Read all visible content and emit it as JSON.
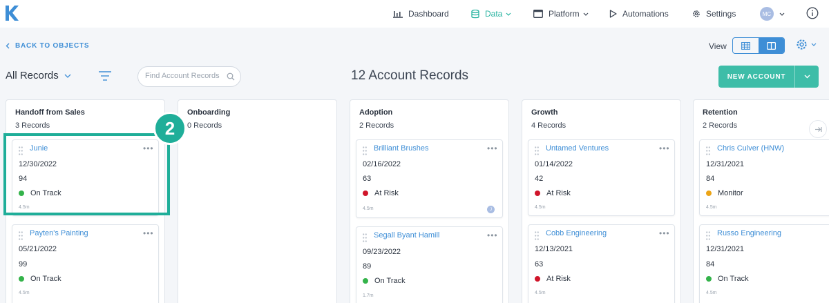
{
  "app": {
    "logo_letter": "K"
  },
  "nav": {
    "dashboard": "Dashboard",
    "data": "Data",
    "platform": "Platform",
    "automations": "Automations",
    "settings": "Settings",
    "user_initials": "MC"
  },
  "subheader": {
    "back_label": "BACK TO OBJECTS",
    "view_label": "View",
    "view_options": [
      "table-view",
      "board-view"
    ],
    "active_view": "board-view"
  },
  "toolbar": {
    "records_dropdown": "All Records",
    "search_placeholder": "Find Account Records",
    "record_count": "12 Account Records",
    "new_button": "NEW ACCOUNT"
  },
  "colors": {
    "accent_teal": "#3dbda8",
    "link_blue": "#3e8ed6",
    "status_on_track": "#34b34a",
    "status_at_risk": "#d0152a",
    "status_monitor": "#eca416"
  },
  "columns": [
    {
      "title": "Handoff from Sales",
      "count": "3 Records",
      "cards": [
        {
          "name": "Junie",
          "date": "12/30/2022",
          "score": "94",
          "status": "On Track",
          "age": "4.5m"
        },
        {
          "name": "Payten's Painting",
          "date": "05/21/2022",
          "score": "99",
          "status": "On Track",
          "age": "4.5m"
        }
      ]
    },
    {
      "title": "Onboarding",
      "count": "0 Records",
      "cards": []
    },
    {
      "title": "Adoption",
      "count": "2 Records",
      "cards": [
        {
          "name": "Brilliant Brushes",
          "date": "02/16/2022",
          "score": "63",
          "status": "At Risk",
          "age": "4.5m",
          "avatar": "J"
        },
        {
          "name": "Segall Byant Hamill",
          "date": "09/23/2022",
          "score": "89",
          "status": "On Track",
          "age": "1.7m"
        }
      ]
    },
    {
      "title": "Growth",
      "count": "4 Records",
      "cards": [
        {
          "name": "Untamed Ventures",
          "date": "01/14/2022",
          "score": "42",
          "status": "At Risk",
          "age": "4.5m"
        },
        {
          "name": "Cobb Engineering",
          "date": "12/13/2021",
          "score": "63",
          "status": "At Risk",
          "age": "4.5m"
        }
      ]
    },
    {
      "title": "Retention",
      "count": "2 Records",
      "cards": [
        {
          "name": "Chris Culver (HNW)",
          "date": "12/31/2021",
          "score": "84",
          "status": "Monitor",
          "age": "4.5m"
        },
        {
          "name": "Russo Engineering",
          "date": "12/31/2021",
          "score": "84",
          "status": "On Track",
          "age": "4.5m"
        }
      ]
    }
  ],
  "annotation": {
    "step_number": "2"
  }
}
